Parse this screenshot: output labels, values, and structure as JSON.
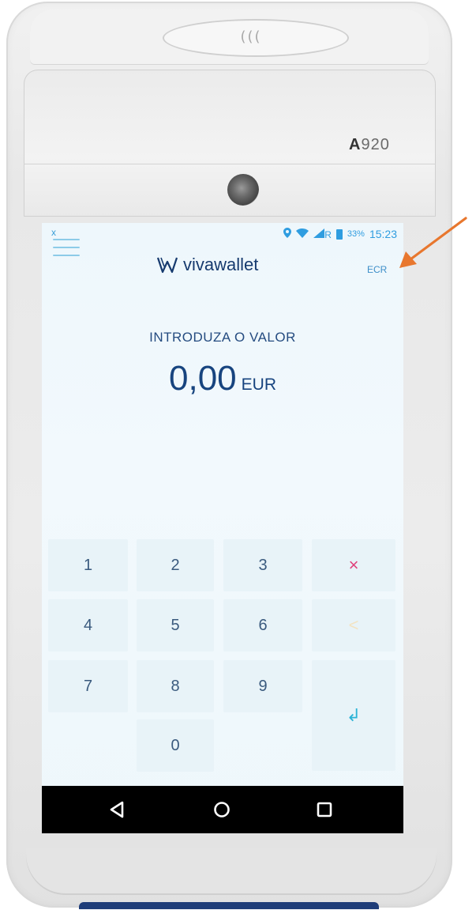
{
  "device": {
    "model_prefix": "A",
    "model_number": "920",
    "contactless_symbol": "((("
  },
  "status_bar": {
    "left_icon": "x",
    "network_letter": "R",
    "battery_percent": "33%",
    "time": "15:23"
  },
  "header": {
    "brand": "vivawallet",
    "ecr_label": "ECR"
  },
  "amount_entry": {
    "prompt": "INTRODUZA O VALOR",
    "value": "0,00",
    "currency": "EUR"
  },
  "keypad": {
    "keys": [
      "1",
      "2",
      "3",
      "4",
      "5",
      "6",
      "7",
      "8",
      "9",
      "0"
    ],
    "clear_symbol": "×",
    "backspace_symbol": "<",
    "enter_symbol": "↲"
  },
  "colors": {
    "accent_navy": "#17447f",
    "screen_bg": "#eef7fc",
    "key_bg": "#e8f3f8",
    "clear_pink": "#e0407a",
    "enter_cyan": "#2bb3d6",
    "arrow_orange": "#e8772e",
    "device_blue": "#1f3d78"
  },
  "icons": {
    "menu": "hamburger-icon",
    "location": "location-pin-icon",
    "wifi": "wifi-icon",
    "signal": "signal-icon",
    "battery": "battery-icon",
    "nav_back": "triangle-back-icon",
    "nav_home": "circle-home-icon",
    "nav_recents": "square-recents-icon"
  }
}
